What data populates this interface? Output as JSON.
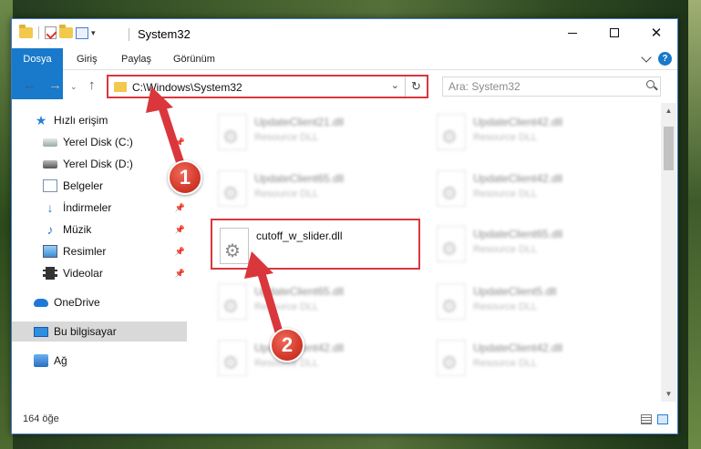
{
  "window": {
    "title": "System32"
  },
  "ribbon": {
    "tabs": [
      "Dosya",
      "Giriş",
      "Paylaş",
      "Görünüm"
    ]
  },
  "address": {
    "path": "C:\\Windows\\System32"
  },
  "search": {
    "placeholder": "Ara: System32"
  },
  "sidebar": {
    "items": [
      {
        "label": "Hızlı erişim",
        "icon": "star-icon"
      },
      {
        "label": "Yerel Disk (C:)",
        "icon": "drive-icon"
      },
      {
        "label": "Yerel Disk (D:)",
        "icon": "drive-icon"
      },
      {
        "label": "Belgeler",
        "icon": "documents-icon"
      },
      {
        "label": "İndirmeler",
        "icon": "download-icon"
      },
      {
        "label": "Müzik",
        "icon": "music-icon"
      },
      {
        "label": "Resimler",
        "icon": "pictures-icon"
      },
      {
        "label": "Videolar",
        "icon": "video-icon"
      },
      {
        "label": "OneDrive",
        "icon": "cloud-icon"
      },
      {
        "label": "Bu bilgisayar",
        "icon": "computer-icon"
      },
      {
        "label": "Ağ",
        "icon": "network-icon"
      }
    ]
  },
  "files": [
    {
      "name": "UpdateClient21.dll",
      "type": "Resource DLL"
    },
    {
      "name": "UpdateClient42.dll",
      "type": "Resource DLL"
    },
    {
      "name": "UpdateClient65.dll",
      "type": "Resource DLL"
    },
    {
      "name": "UpdateClient42.dll",
      "type": "Resource DLL"
    },
    {
      "name": "cutoff_w_slider.dll",
      "type": ""
    },
    {
      "name": "UpdateClient65.dll",
      "type": "Resource DLL"
    },
    {
      "name": "UpdateClient65.dll",
      "type": "Resource DLL"
    },
    {
      "name": "UpdateClient5.dll",
      "type": "Resource DLL"
    },
    {
      "name": "UpdateClient42.dll",
      "type": "Resource DLL"
    },
    {
      "name": "UpdateClient42.dll",
      "type": "Resource DLL"
    }
  ],
  "status": {
    "item_count": "164 öğe"
  },
  "annotations": {
    "step1": "1",
    "step2": "2",
    "color": "#d9373c"
  }
}
